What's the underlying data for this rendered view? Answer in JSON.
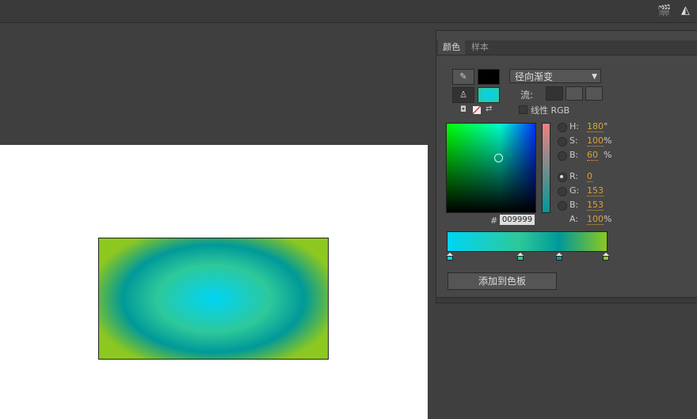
{
  "panel": {
    "tabs": [
      "颜色",
      "样本"
    ],
    "gradient_type": "径向渐变",
    "flow_label": "流:",
    "linear_rgb_label": "线性 RGB",
    "hsb": [
      {
        "label": "H:",
        "value": "180",
        "unit": "°"
      },
      {
        "label": "S:",
        "value": "100",
        "unit": "%"
      },
      {
        "label": "B:",
        "value": "60",
        "unit": "%"
      }
    ],
    "rgb": [
      {
        "label": "R:",
        "value": "0",
        "selected": true
      },
      {
        "label": "G:",
        "value": "153"
      },
      {
        "label": "B:",
        "value": "153"
      }
    ],
    "alpha": {
      "label": "A:",
      "value": "100",
      "unit": "%"
    },
    "hex_label": "#",
    "hex": "009999",
    "gradient_stops": [
      {
        "color": "#00d4f5",
        "pos": 0
      },
      {
        "color": "#2ec89a",
        "pos": 45
      },
      {
        "color": "#009999",
        "pos": 70
      },
      {
        "color": "#8cc820",
        "pos": 100
      }
    ],
    "add_swatch": "添加到色板"
  },
  "icons": [
    "clapperboard-icon",
    "shape-tools-icon",
    "pencil-icon",
    "paint-bucket-icon"
  ]
}
